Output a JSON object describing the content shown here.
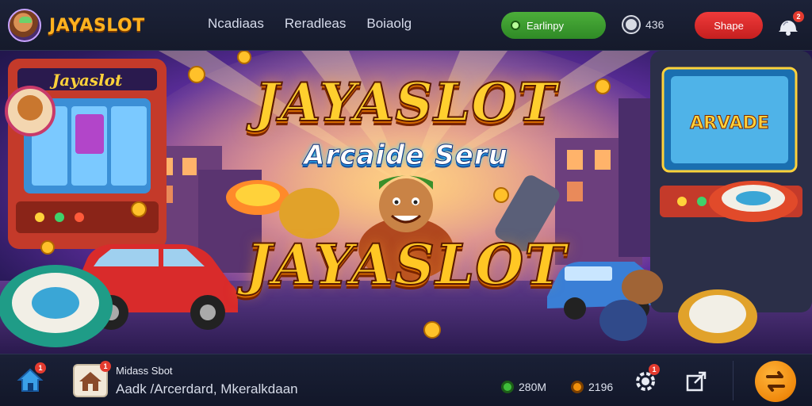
{
  "header": {
    "brand_name": "JAYASLOT",
    "nav": [
      "Ncadiaas",
      "Reradleas",
      "Boiaolg"
    ],
    "status_label": "Earlinpy",
    "coin_count": "436",
    "share_label": "Shape"
  },
  "hero": {
    "title_top": "JAYASLOT",
    "subtitle": "Arcaide Seru",
    "title_bottom": "JAYASLOT",
    "cabinet_screen_label": "ARVADE",
    "cabinet_sign": "Jayaslot"
  },
  "bottom": {
    "game_title": "Midass Sbot",
    "game_subtitle": "Aadk /Arcerdard, Mkeralkdaan",
    "stat_green": "280M",
    "stat_orange": "2196",
    "home_badge": "1",
    "thumb_badge": "1",
    "settings_badge": "1",
    "bell_badge": "2"
  },
  "colors": {
    "accent_gold": "#ffc724",
    "status_green": "#3f9e31",
    "share_red": "#d92b2b",
    "fab_orange": "#f0890c",
    "bar_bg": "#151a2b"
  },
  "icons": [
    "avatar-icon",
    "status-dot-icon",
    "coin-icon",
    "bell-icon",
    "home-icon",
    "settings-icon",
    "external-link-icon",
    "swap-icon"
  ]
}
